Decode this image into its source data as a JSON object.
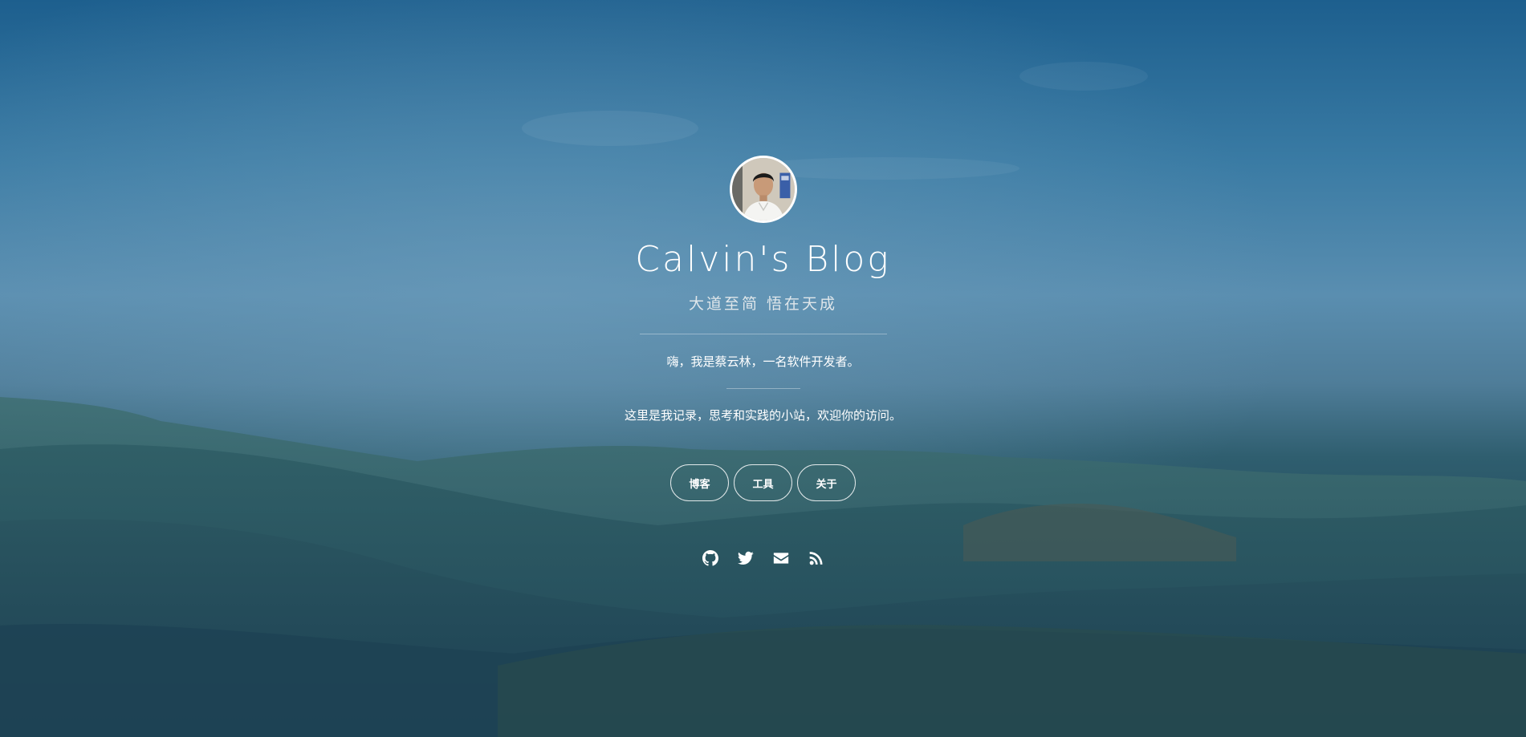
{
  "site": {
    "title": "Calvin's Blog",
    "subtitle": "大道至简 悟在天成"
  },
  "intro": {
    "line1": "嗨，我是蔡云林，一名软件开发者。",
    "line2": "这里是我记录，思考和实践的小站，欢迎你的访问。"
  },
  "nav": {
    "items": [
      {
        "label": "博客"
      },
      {
        "label": "工具"
      },
      {
        "label": "关于"
      }
    ]
  },
  "social": {
    "icons": [
      "github-icon",
      "twitter-icon",
      "mail-icon",
      "rss-icon"
    ]
  },
  "colors": {
    "text": "#ffffff",
    "sky_top": "#1d5f8e",
    "hills": "#244d5e"
  }
}
